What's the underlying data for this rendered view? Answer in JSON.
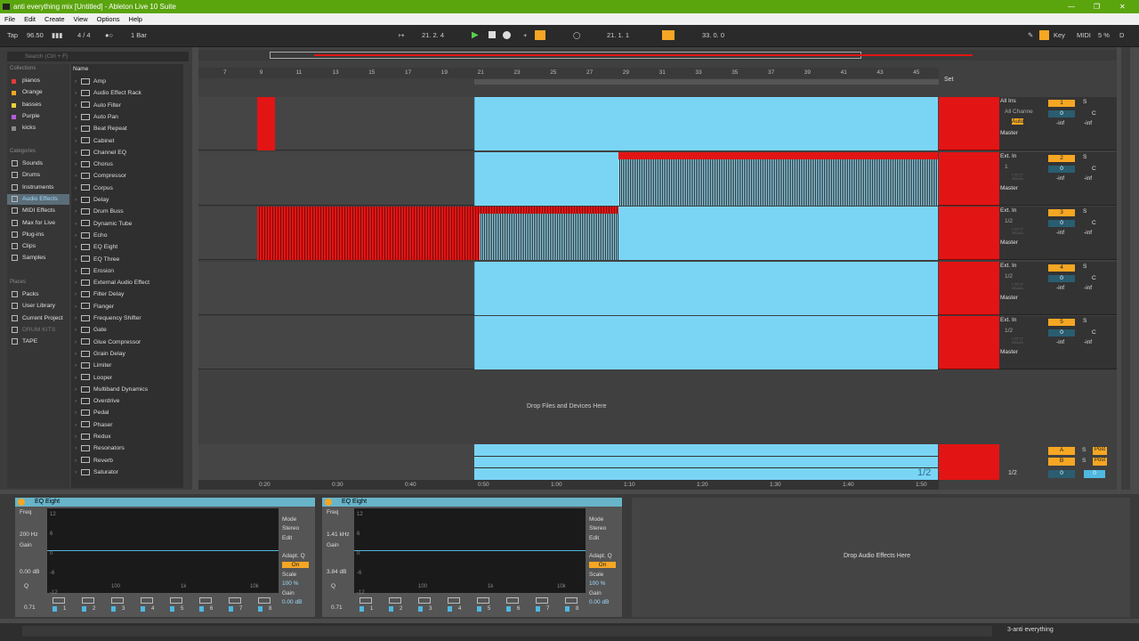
{
  "window": {
    "title": "anti everything mix  [Untitled] - Ableton Live 10 Suite"
  },
  "menu": [
    "File",
    "Edit",
    "Create",
    "View",
    "Options",
    "Help"
  ],
  "transport": {
    "tap": "Tap",
    "tempo": "96.50",
    "signature": "4 / 4",
    "quantize": "1 Bar",
    "position": "21.   2.   4",
    "loop_start": "21.   1.   1",
    "loop_length": "33.   0.   0",
    "key": "Key",
    "midi": "MIDI",
    "cpu": "5 %",
    "d": "D"
  },
  "browser": {
    "search_placeholder": "Search (Ctrl + F)",
    "collections_label": "Collections",
    "collections": [
      {
        "label": "pianos",
        "color": "#e23b3b"
      },
      {
        "label": "Orange",
        "color": "#f5a623"
      },
      {
        "label": "basses",
        "color": "#e9d13a"
      },
      {
        "label": "Purple",
        "color": "#b45cdc"
      },
      {
        "label": "kicks",
        "color": "#8a8a8a"
      }
    ],
    "categories_label": "Categories",
    "categories": [
      "Sounds",
      "Drums",
      "Instruments",
      "Audio Effects",
      "MIDI Effects",
      "Max for Live",
      "Plug-ins",
      "Clips",
      "Samples"
    ],
    "places_label": "Places",
    "places": [
      "Packs",
      "User Library",
      "Current Project",
      "DRUM KITS",
      "TAPE"
    ],
    "name_header": "Name",
    "items": [
      "Amp",
      "Audio Effect Rack",
      "Auto Filter",
      "Auto Pan",
      "Beat Repeat",
      "Cabinet",
      "Channel EQ",
      "Chorus",
      "Compressor",
      "Corpus",
      "Delay",
      "Drum Buss",
      "Dynamic Tube",
      "Echo",
      "EQ Eight",
      "EQ Three",
      "Erosion",
      "External Audio Effect",
      "Filter Delay",
      "Flanger",
      "Frequency Shifter",
      "Gate",
      "Glue Compressor",
      "Grain Delay",
      "Limiter",
      "Looper",
      "Multiband Dynamics",
      "Overdrive",
      "Pedal",
      "Phaser",
      "Redux",
      "Resonators",
      "Reverb",
      "Saturator"
    ]
  },
  "arrangement": {
    "bar_numbers": [
      "7",
      "9",
      "11",
      "13",
      "15",
      "17",
      "19",
      "21",
      "23",
      "25",
      "27",
      "29",
      "31",
      "33",
      "35",
      "37",
      "39",
      "41",
      "43",
      "45"
    ],
    "time_labels": [
      "0:20",
      "0:30",
      "0:40",
      "0:50",
      "1:00",
      "1:10",
      "1:20",
      "1:30",
      "1:40",
      "1:50"
    ],
    "set_label": "Set",
    "drop_text": "Drop Files and Devices Here",
    "ratio_label": "1/2"
  },
  "tracks": [
    {
      "num": "1",
      "input": "All Ins",
      "sub": "All Channe",
      "monitor": [
        "In",
        "Auto",
        "Off"
      ],
      "vol": "0",
      "pan": "C",
      "meters": [
        "-inf",
        "-inf"
      ],
      "out": "Master"
    },
    {
      "num": "2",
      "input": "Ext. In",
      "sub": "1",
      "monitor": [
        "In",
        "Auto",
        "Off"
      ],
      "vol": "0",
      "pan": "C",
      "meters": [
        "-inf",
        "-inf"
      ],
      "out": "Master"
    },
    {
      "num": "3",
      "input": "Ext. In",
      "sub": "1/2",
      "monitor": [
        "In",
        "Auto",
        "Off"
      ],
      "vol": "0",
      "pan": "C",
      "meters": [
        "-inf",
        "-inf"
      ],
      "out": "Master"
    },
    {
      "num": "4",
      "input": "Ext. In",
      "sub": "1/2",
      "monitor": [
        "In",
        "Auto",
        "Off"
      ],
      "vol": "0",
      "pan": "C",
      "meters": [
        "-inf",
        "-inf"
      ],
      "out": "Master"
    },
    {
      "num": "5",
      "input": "Ext. In",
      "sub": "1/2",
      "monitor": [
        "In",
        "Auto",
        "Off"
      ],
      "vol": "0",
      "pan": "C",
      "meters": [
        "-inf",
        "-inf"
      ],
      "out": "Master"
    }
  ],
  "returns": [
    {
      "letter": "A",
      "s": "S",
      "post": "Post"
    },
    {
      "letter": "B",
      "s": "S",
      "post": "Post"
    }
  ],
  "master": {
    "ratio": "1/2",
    "vol": "0",
    "pan": "0"
  },
  "devices": [
    {
      "name": "EQ Eight",
      "freq_label": "Freq",
      "freq": "200 Hz",
      "gain_label": "Gain",
      "gain": "0.00 dB",
      "q_label": "Q",
      "q": "0.71",
      "mode_label": "Mode",
      "mode": "Stereo",
      "edit": "Edit",
      "adapt": "Adapt. Q",
      "adapt_val": "On",
      "scale_label": "Scale",
      "scale": "100 %",
      "gain2_label": "Gain",
      "gain2": "0.00 dB",
      "db_ticks": [
        "12",
        "6",
        "0",
        "-6",
        "-12"
      ],
      "freq_ticks": [
        "100",
        "1k",
        "10k"
      ],
      "bands": [
        "1",
        "2",
        "3",
        "4",
        "5",
        "6",
        "7",
        "8"
      ]
    },
    {
      "name": "EQ Eight",
      "freq_label": "Freq",
      "freq": "1.41 kHz",
      "gain_label": "Gain",
      "gain": "3.84 dB",
      "q_label": "Q",
      "q": "0.71",
      "mode_label": "Mode",
      "mode": "Stereo",
      "edit": "Edit",
      "adapt": "Adapt. Q",
      "adapt_val": "On",
      "scale_label": "Scale",
      "scale": "100 %",
      "gain2_label": "Gain",
      "gain2": "0.00 dB",
      "db_ticks": [
        "12",
        "6",
        "0",
        "-6",
        "-12"
      ],
      "freq_ticks": [
        "100",
        "1k",
        "10k"
      ],
      "bands": [
        "1",
        "2",
        "3",
        "4",
        "5",
        "6",
        "7",
        "8"
      ]
    }
  ],
  "drop_effects": "Drop Audio Effects Here",
  "status": {
    "track": "3-anti everything"
  },
  "colors": {
    "accent": "#f5a623",
    "clip_cyan": "#7ad5f5",
    "clip_red": "#e31414",
    "title_green": "#5aa40e"
  }
}
